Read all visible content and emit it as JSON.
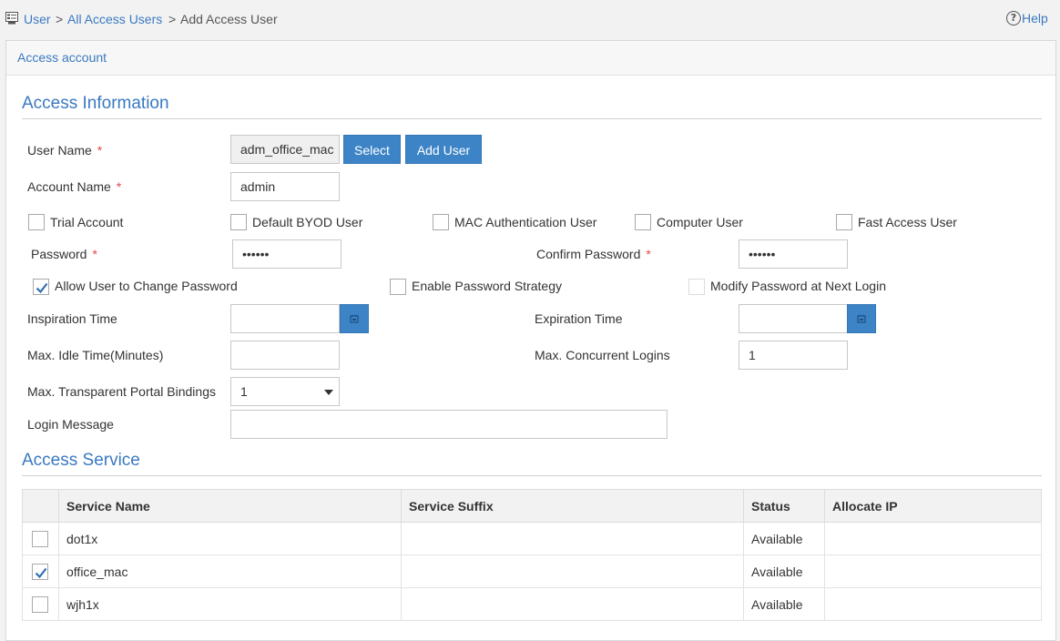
{
  "breadcrumb": {
    "items": [
      "User",
      "All Access Users",
      "Add Access User"
    ],
    "separator": ">",
    "help": "Help"
  },
  "panel": {
    "title": "Access account"
  },
  "access_information": {
    "title": "Access Information",
    "user_name": {
      "label": "User Name",
      "required": "*",
      "value": "adm_office_mac"
    },
    "select_button": "Select",
    "add_user_button": "Add User",
    "account_name": {
      "label": "Account Name",
      "required": "*",
      "value": "admin"
    },
    "account_types": [
      {
        "label": "Trial Account",
        "checked": false
      },
      {
        "label": "Default BYOD User",
        "checked": false
      },
      {
        "label": "MAC Authentication User",
        "checked": false
      },
      {
        "label": "Computer User",
        "checked": false
      },
      {
        "label": "Fast Access User",
        "checked": false
      }
    ],
    "password": {
      "label": "Password",
      "required": "*",
      "value": "••••••"
    },
    "confirm_password": {
      "label": "Confirm Password",
      "required": "*",
      "value": "••••••"
    },
    "password_options": [
      {
        "label": "Allow User to Change Password",
        "checked": true
      },
      {
        "label": "Enable Password Strategy",
        "checked": false
      },
      {
        "label": "Modify Password at Next Login",
        "checked": false,
        "disabled": true
      }
    ],
    "inspiration_time": {
      "label": "Inspiration Time",
      "value": ""
    },
    "expiration_time": {
      "label": "Expiration Time",
      "value": ""
    },
    "max_idle_time": {
      "label": "Max. Idle Time(Minutes)",
      "value": ""
    },
    "max_concurrent_logins": {
      "label": "Max. Concurrent Logins",
      "value": "1"
    },
    "max_transparent_portal_bindings": {
      "label": "Max. Transparent Portal Bindings",
      "value": "1"
    },
    "login_message": {
      "label": "Login Message",
      "value": ""
    }
  },
  "access_service": {
    "title": "Access Service",
    "columns": [
      "",
      "Service Name",
      "Service Suffix",
      "Status",
      "Allocate IP"
    ],
    "rows": [
      {
        "checked": false,
        "service_name": "dot1x",
        "service_suffix": "",
        "status": "Available",
        "allocate_ip": ""
      },
      {
        "checked": true,
        "service_name": "office_mac",
        "service_suffix": "",
        "status": "Available",
        "allocate_ip": ""
      },
      {
        "checked": false,
        "service_name": "wjh1x",
        "service_suffix": "",
        "status": "Available",
        "allocate_ip": ""
      }
    ]
  },
  "colors": {
    "accent": "#3a79c1",
    "button": "#3d84c6",
    "required": "#e04a4a"
  },
  "icons": [
    "user-list-icon",
    "help-icon",
    "calendar-icon",
    "checkmark-icon",
    "caret-down-icon"
  ]
}
